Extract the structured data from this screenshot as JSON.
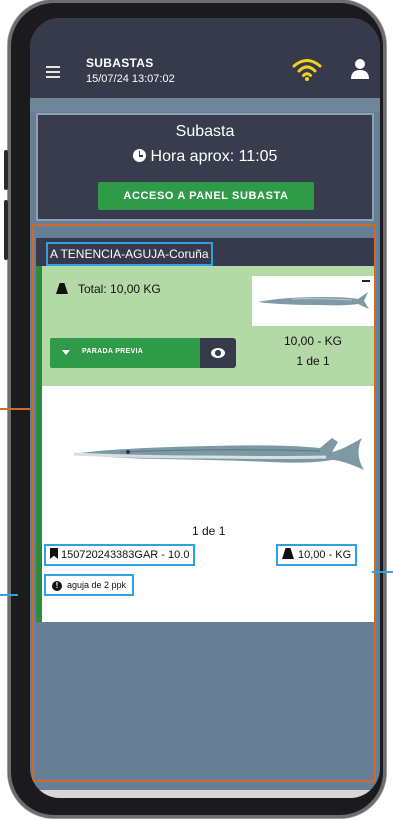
{
  "header": {
    "title": "SUBASTAS",
    "datetime": "15/07/24 13:07:02"
  },
  "auction": {
    "title": "Subasta",
    "approx_time": "Hora aprox: 11:05",
    "panel_button": "ACCESO A PANEL SUBASTA"
  },
  "lot": {
    "name": "A TENENCIA-AGUJA-Coruña",
    "total": "Total: 10,00 KG",
    "thumb_weight": "10,00 - KG",
    "thumb_count": "1 de 1",
    "parada_button": "PARADA PREVIA",
    "image_counter": "1 de 1",
    "code": "150720243383GAR - 10.0",
    "weight": "10,00 - KG",
    "info": "aguja de 2 ppk"
  },
  "colors": {
    "header_bg": "#363a4a",
    "accent_green": "#2f9a48",
    "light_green": "#b2d9a6",
    "highlight_blue": "#2ba3e2",
    "highlight_orange": "#d06a2c",
    "wifi_yellow": "#f2d21b"
  },
  "icons": [
    "menu-icon",
    "wifi-icon",
    "user-icon",
    "clock-icon",
    "weight-icon",
    "caret-down-icon",
    "eye-icon",
    "bookmark-icon",
    "info-icon"
  ]
}
